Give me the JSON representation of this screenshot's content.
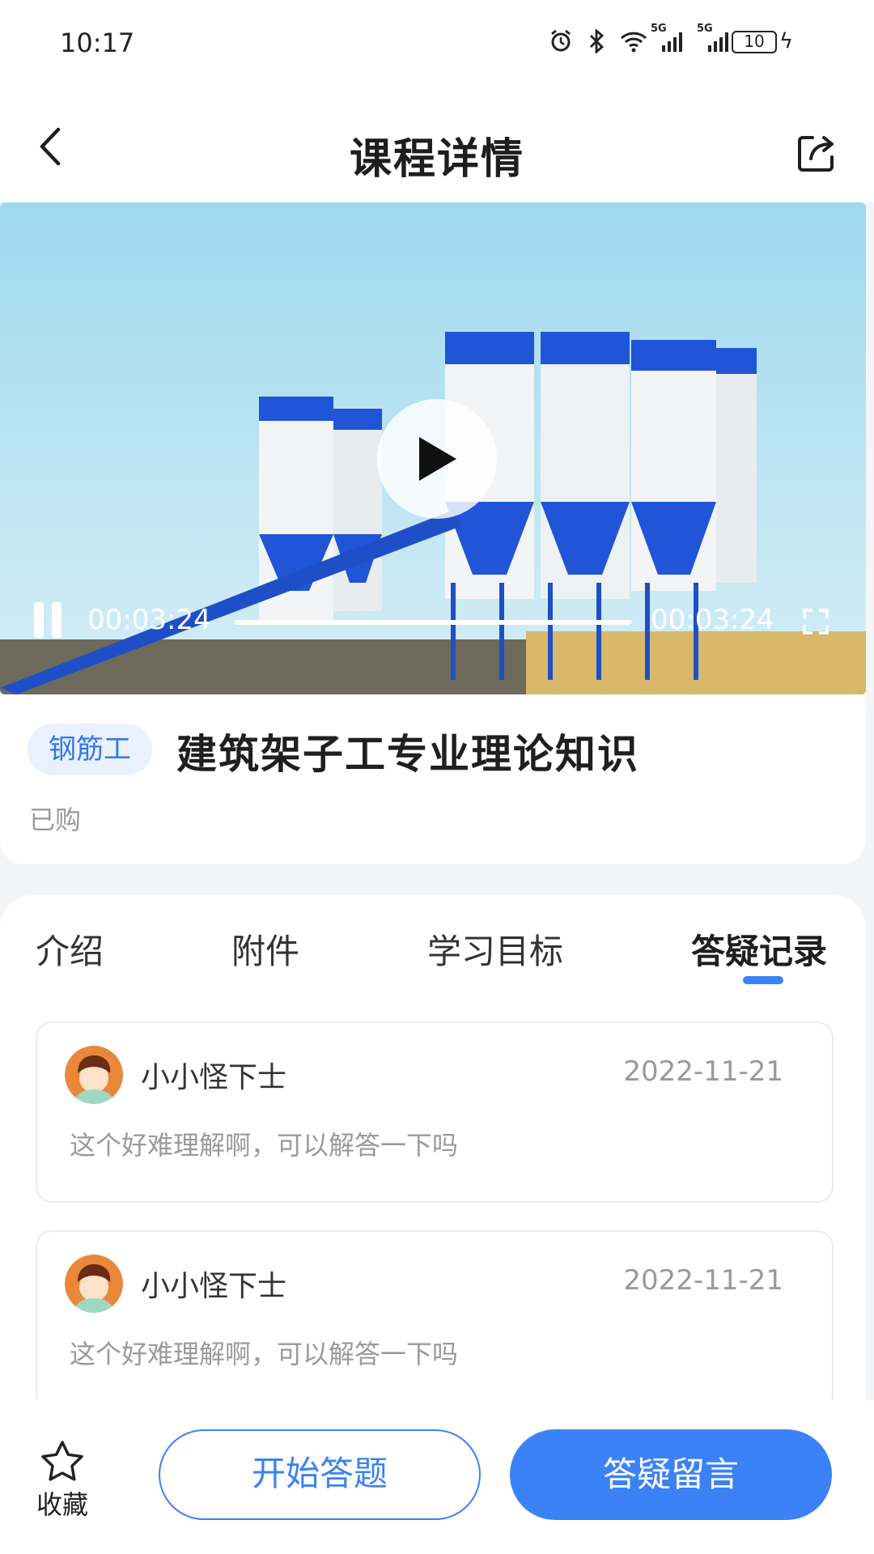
{
  "status_bar": {
    "time": "10:17",
    "network_1": "5G",
    "network_2": "5G",
    "battery": "10"
  },
  "header": {
    "title": "课程详情"
  },
  "video": {
    "current_time": "00:03:24",
    "duration": "00:03:24",
    "progress": 1.0
  },
  "course": {
    "tag": "钢筋工",
    "name": "建筑架子工专业理论知识",
    "status": "已购"
  },
  "tabs": [
    {
      "label": "介绍"
    },
    {
      "label": "附件"
    },
    {
      "label": "学习目标"
    },
    {
      "label": "答疑记录"
    }
  ],
  "active_tab": 3,
  "qa_records": [
    {
      "user": "小小怪下士",
      "date": "2022-11-21",
      "message": "这个好难理解啊，可以解答一下吗"
    },
    {
      "user": "小小怪下士",
      "date": "2022-11-21",
      "message": "这个好难理解啊，可以解答一下吗"
    }
  ],
  "bottom_bar": {
    "favorite_label": "收藏",
    "start_quiz_label": "开始答题",
    "ask_label": "答疑留言"
  },
  "colors": {
    "accent": "#3b82f6",
    "tag_bg": "#e8f1fd",
    "muted_text": "#9a9a9a"
  }
}
